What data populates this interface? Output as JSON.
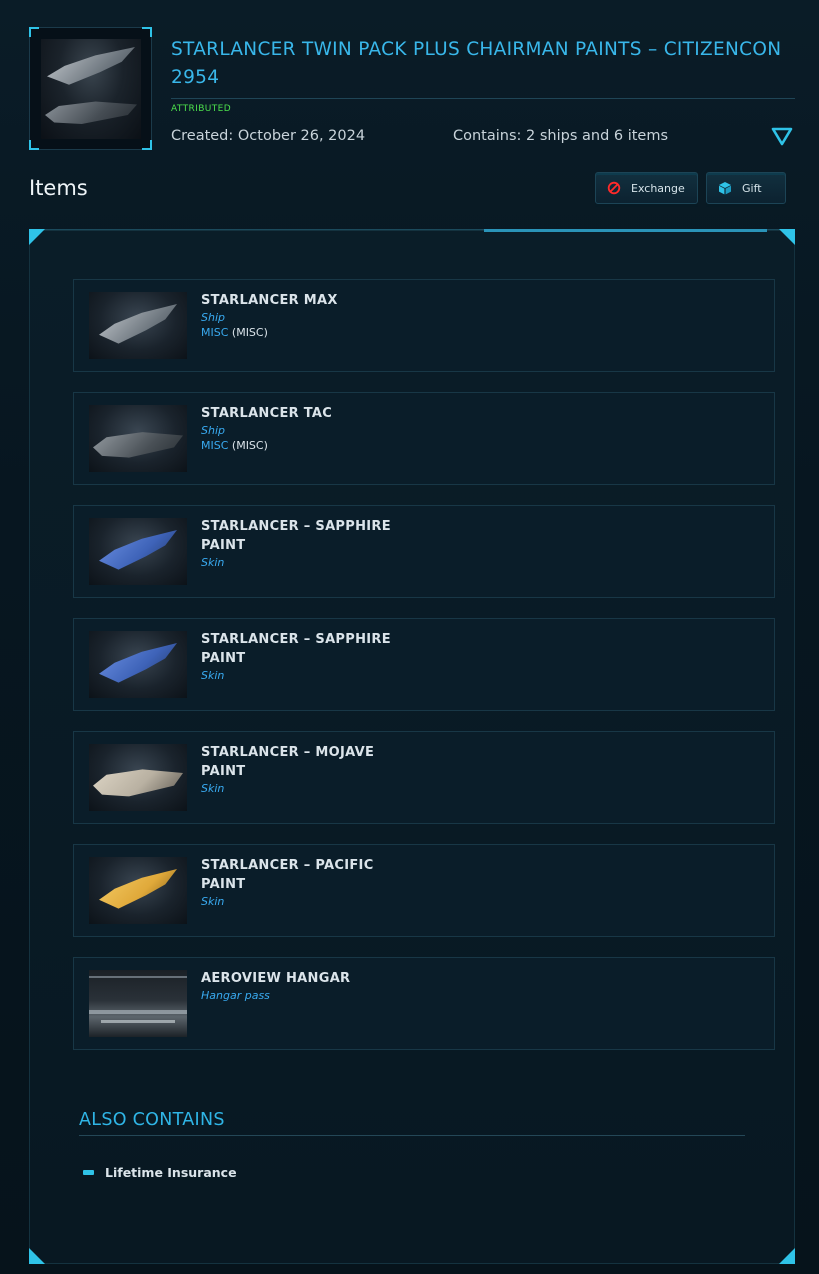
{
  "header": {
    "title": "STARLANCER TWIN PACK PLUS CHAIRMAN PAINTS – CITIZENCON 2954",
    "status": "ATTRIBUTED",
    "created": "Created: October 26, 2024",
    "contains": "Contains: 2 ships and 6 items",
    "thumbnail_icon": "ship-thumbnail",
    "expand_icon": "expand-triangle-icon"
  },
  "items_section": {
    "title": "Items",
    "exchange_label": "Exchange",
    "gift_label": "Gift"
  },
  "items": [
    {
      "name": "STARLANCER MAX",
      "type": "Ship",
      "manufacturer": "MISC",
      "manufacturer_code": "(MISC)",
      "color": "#9aa3ab"
    },
    {
      "name": "STARLANCER TAC",
      "type": "Ship",
      "manufacturer": "MISC",
      "manufacturer_code": "(MISC)",
      "color": "#7d858c"
    },
    {
      "name": "STARLANCER – SAPPHIRE PAINT",
      "type": "Skin",
      "color": "#3e63b8"
    },
    {
      "name": "STARLANCER – SAPPHIRE PAINT",
      "type": "Skin",
      "color": "#3e63b8"
    },
    {
      "name": "STARLANCER – MOJAVE PAINT",
      "type": "Skin",
      "color": "#b9b1a2"
    },
    {
      "name": "STARLANCER – PACIFIC PAINT",
      "type": "Skin",
      "color": "#e0a93a"
    },
    {
      "name": "AEROVIEW HANGAR",
      "type": "Hangar pass",
      "color": "#8c949a"
    }
  ],
  "also_contains": {
    "title": "ALSO CONTAINS",
    "items": [
      "Lifetime Insurance"
    ]
  },
  "colors": {
    "accent": "#2fc3e8",
    "title_blue": "#39b7ea",
    "attributed_green": "#4ce04c",
    "link_blue": "#39aaf0",
    "exchange_icon_red": "#ff2a2a"
  }
}
